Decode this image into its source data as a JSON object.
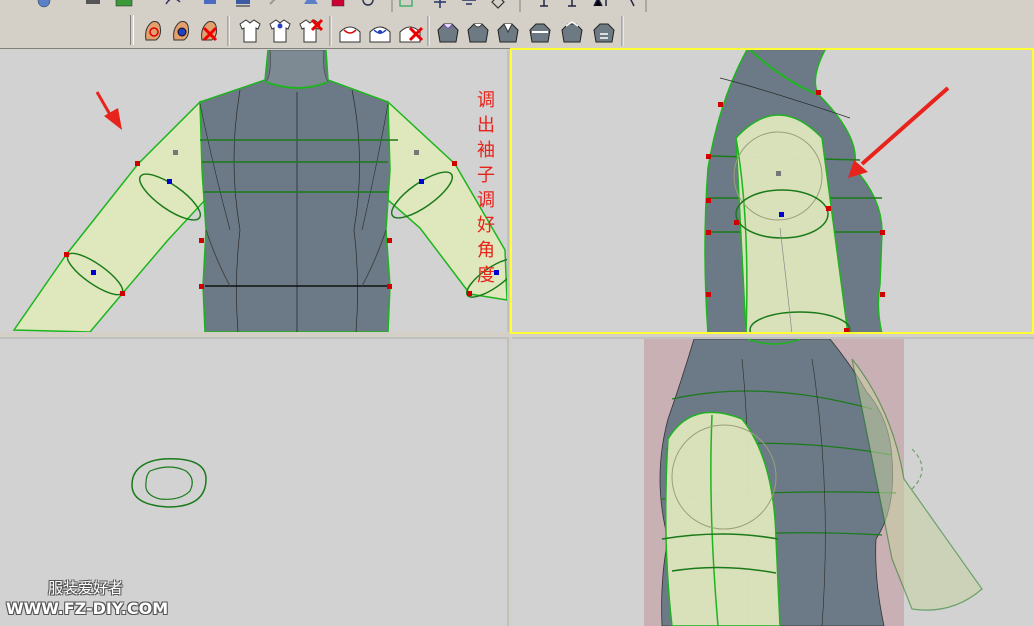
{
  "toolbar": {
    "row1_icons": [
      "globe-icon",
      "print-icon",
      "image-icon",
      "undo-icon",
      "save-icon",
      "export-icon",
      "arrow-icon",
      "shirt-color-icon",
      "layers-icon",
      "refresh-icon",
      "grid-icon",
      "table-icon",
      "tree-icon",
      "diamond-icon",
      "cursor-tool-icon",
      "pin-icon",
      "multi-pin-icon",
      "target-icon"
    ],
    "row2_icons": [
      "select-point-icon",
      "add-point-icon",
      "delete-point-icon",
      "shirt-icon",
      "shirt-add-icon",
      "shirt-delete-icon",
      "collar-icon",
      "collar-add-icon",
      "collar-delete-icon",
      "mannequin-neck-icon",
      "mannequin-shoulder-icon",
      "mannequin-torso-icon",
      "mannequin-chest-icon",
      "mannequin-waist-icon",
      "mannequin-hip-icon"
    ]
  },
  "viewports": [
    {
      "name": "front-view",
      "active": false
    },
    {
      "name": "side-view",
      "active": true
    },
    {
      "name": "top-view",
      "active": false
    },
    {
      "name": "perspective-view",
      "active": false
    }
  ],
  "annotation": {
    "line1": "调出袖子",
    "line2": "调好角度",
    "color": "#e8231b"
  },
  "watermark": {
    "line1": "服装爱好者",
    "line2": "WWW.FZ-DIY.COM"
  },
  "colors": {
    "mannequin": "#6b7a86",
    "sleeve": "#dfe7bd",
    "wire": "#1db51d",
    "active_border": "#ffff33",
    "point_red": "#d00000",
    "point_blue": "#0000d0"
  }
}
